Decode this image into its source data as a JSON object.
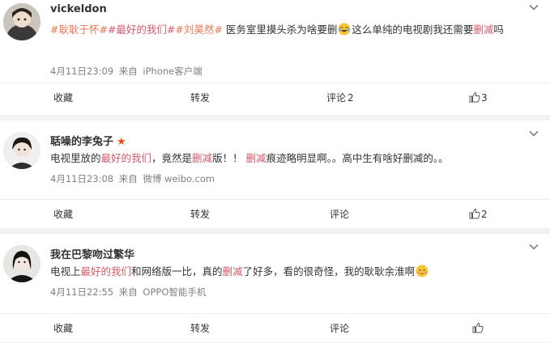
{
  "posts": [
    {
      "username": "vickeldon",
      "text_parts": [
        {
          "t": "#耿耿于怀#",
          "c": "topic"
        },
        {
          "t": "#最好的我们#",
          "c": "hl"
        },
        {
          "t": "#刘昊然#",
          "c": "topic"
        },
        {
          "t": " 医务室里摸头杀为啥要删",
          "c": ""
        },
        {
          "t": "emoji:laugh-cry",
          "c": "emoji"
        },
        {
          "t": "这么单纯的电视剧我还需要",
          "c": ""
        },
        {
          "t": "删减",
          "c": "hl"
        },
        {
          "t": "吗",
          "c": ""
        }
      ],
      "time": "4月11日23:09",
      "source_prefix": "来自",
      "source": "iPhone客户端",
      "actions": {
        "favorite": "收藏",
        "repost": "转发",
        "comment": "评论",
        "comment_count": "2",
        "like_count": "3"
      }
    },
    {
      "username": "聒噪的李兔子",
      "text_parts": [
        {
          "t": "电视里放的",
          "c": ""
        },
        {
          "t": "最好的我们",
          "c": "hl"
        },
        {
          "t": "，竟然是",
          "c": ""
        },
        {
          "t": "删减",
          "c": "hl"
        },
        {
          "t": "版！！ ",
          "c": ""
        },
        {
          "t": "删减",
          "c": "hl"
        },
        {
          "t": "痕迹略明显啊。。高中生有啥好删减的。。",
          "c": ""
        }
      ],
      "time": "4月11日23:08",
      "source_prefix": "来自",
      "source": "微博 weibo.com",
      "actions": {
        "favorite": "收藏",
        "repost": "转发",
        "comment": "评论",
        "comment_count": "",
        "like_count": "2"
      }
    },
    {
      "username": "我在巴黎吻过繁华",
      "text_parts": [
        {
          "t": "电视上",
          "c": ""
        },
        {
          "t": "最好的我们",
          "c": "hl"
        },
        {
          "t": "和网络版一比，真的",
          "c": ""
        },
        {
          "t": "删减",
          "c": "hl"
        },
        {
          "t": "了好多，看的很奇怪，我的耿耿余淮啊",
          "c": ""
        },
        {
          "t": "emoji:shy",
          "c": "emoji"
        }
      ],
      "time": "4月11日22:55",
      "source_prefix": "来自",
      "source": "OPPO智能手机",
      "actions": {
        "favorite": "收藏",
        "repost": "转发",
        "comment": "评论",
        "comment_count": "",
        "like_count": ""
      }
    }
  ],
  "colors": {
    "topic": "#eb7350",
    "highlight": "#d7586b",
    "star": "#f04a12",
    "meta": "#808080"
  },
  "icons": {
    "menu": "chevron-down-icon",
    "like": "thumbs-up-icon",
    "vip": "star-icon"
  }
}
